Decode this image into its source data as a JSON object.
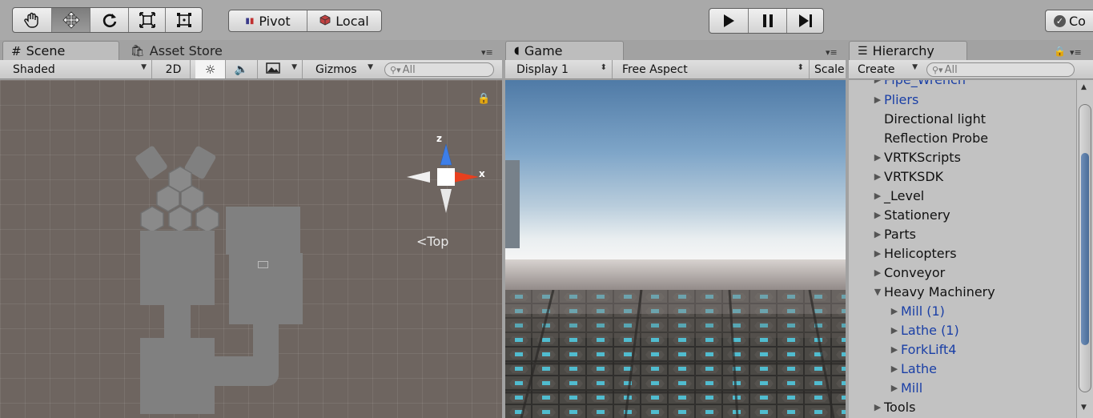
{
  "toolbar": {
    "tools": [
      "hand-tool",
      "move-tool",
      "rotate-tool",
      "scale-tool",
      "rect-tool"
    ],
    "pivot_label": "Pivot",
    "local_label": "Local",
    "collab_label": "Co"
  },
  "scene_panel": {
    "tab_scene": "Scene",
    "tab_asset_store": "Asset Store",
    "shading_mode": "Shaded",
    "mode_2d": "2D",
    "gizmos_label": "Gizmos",
    "search_placeholder": "All",
    "gizmo_axes": {
      "z": "z",
      "x": "x"
    },
    "view_label": "Top"
  },
  "game_panel": {
    "tab_game": "Game",
    "display": "Display 1",
    "aspect": "Free Aspect",
    "scale_label": "Scale"
  },
  "hierarchy_panel": {
    "tab_label": "Hierarchy",
    "create_label": "Create",
    "search_placeholder": "All",
    "partial_item": "Pipe_Wrench",
    "items": [
      {
        "label": "Pliers",
        "indent": 1,
        "expander": "collapsed",
        "prefab": true
      },
      {
        "label": "Directional light",
        "indent": 1,
        "expander": "none",
        "prefab": false
      },
      {
        "label": "Reflection Probe",
        "indent": 1,
        "expander": "none",
        "prefab": false
      },
      {
        "label": "VRTKScripts",
        "indent": 0,
        "expander": "collapsed",
        "prefab": false
      },
      {
        "label": "VRTKSDK",
        "indent": 0,
        "expander": "collapsed",
        "prefab": false
      },
      {
        "label": "_Level",
        "indent": 0,
        "expander": "collapsed",
        "prefab": false
      },
      {
        "label": "Stationery",
        "indent": 0,
        "expander": "collapsed",
        "prefab": false
      },
      {
        "label": "Parts",
        "indent": 0,
        "expander": "collapsed",
        "prefab": false
      },
      {
        "label": "Helicopters",
        "indent": 0,
        "expander": "collapsed",
        "prefab": false
      },
      {
        "label": "Conveyor",
        "indent": 0,
        "expander": "collapsed",
        "prefab": false
      },
      {
        "label": "Heavy Machinery",
        "indent": 0,
        "expander": "expanded",
        "prefab": false
      },
      {
        "label": "Mill (1)",
        "indent": 1,
        "expander": "collapsed",
        "prefab": true
      },
      {
        "label": "Lathe (1)",
        "indent": 1,
        "expander": "collapsed",
        "prefab": true
      },
      {
        "label": "ForkLift4",
        "indent": 1,
        "expander": "collapsed",
        "prefab": true
      },
      {
        "label": "Lathe",
        "indent": 1,
        "expander": "collapsed",
        "prefab": true
      },
      {
        "label": "Mill",
        "indent": 1,
        "expander": "collapsed",
        "prefab": true
      },
      {
        "label": "Tools",
        "indent": 0,
        "expander": "collapsed",
        "prefab": false
      }
    ]
  },
  "colors": {
    "prefab_text": "#1a3fa6",
    "gizmo_x": "#e8401f",
    "gizmo_z": "#3d7ee8"
  }
}
